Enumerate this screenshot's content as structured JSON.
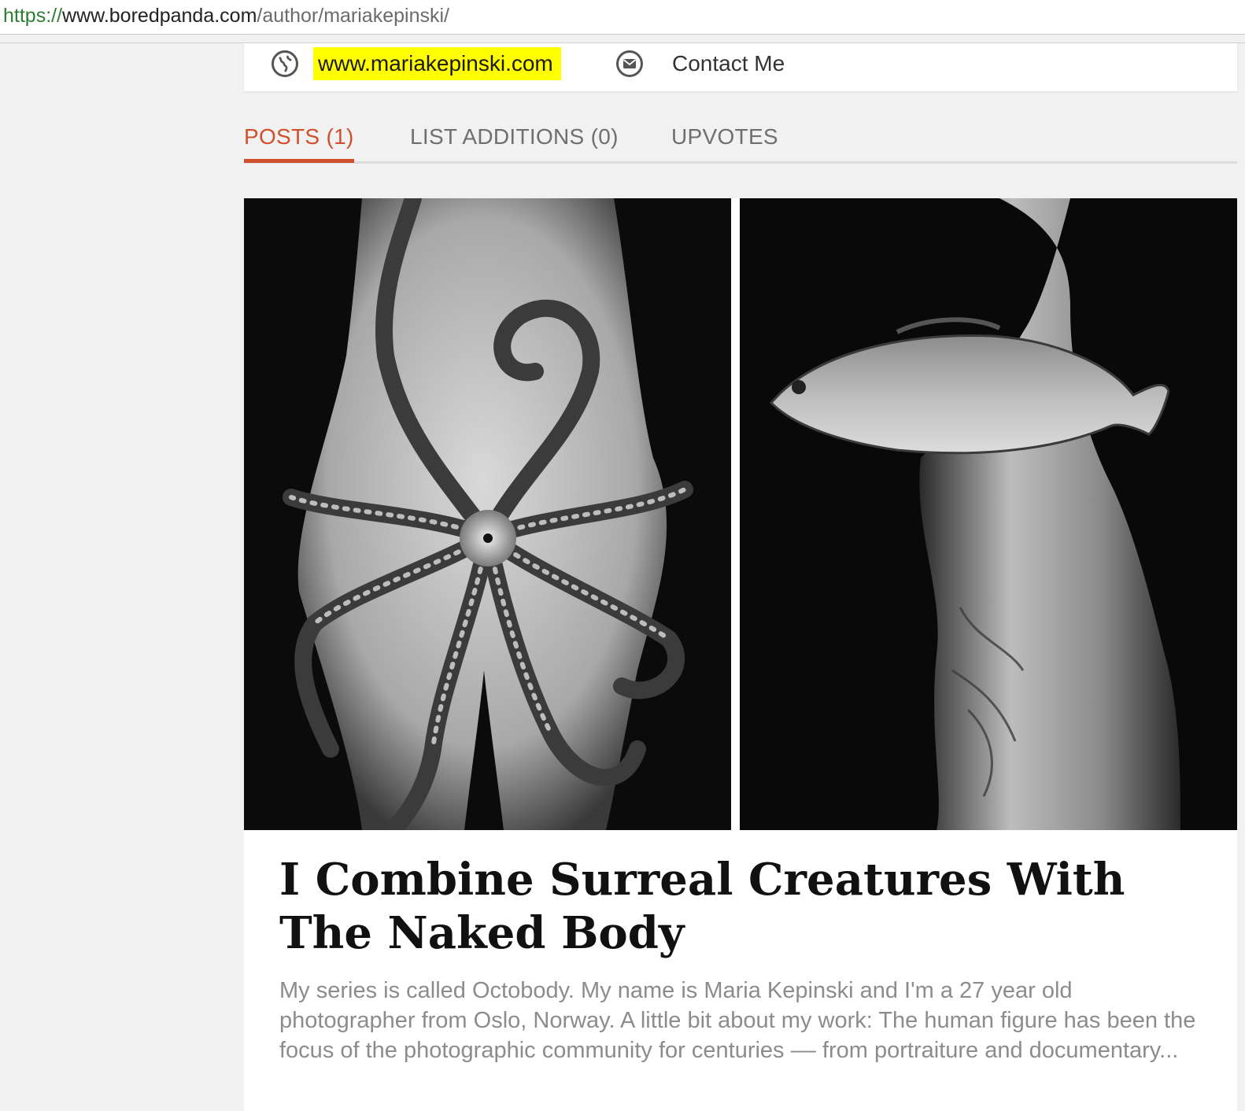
{
  "browser": {
    "url_scheme": "https://",
    "url_host": "www.boredpanda.com",
    "url_path": "/author/mariakepinski/"
  },
  "profile_links": {
    "website_label": "www.mariakepinski.com",
    "website_icon": "globe-icon",
    "contact_label": "Contact Me",
    "contact_icon": "envelope-icon",
    "highlight_color": "#ffff00"
  },
  "tabs": [
    {
      "label": "POSTS (1)",
      "active": true
    },
    {
      "label": "LIST ADDITIONS (0)",
      "active": false
    },
    {
      "label": "UPVOTES",
      "active": false
    }
  ],
  "accent_color": "#d1502c",
  "post": {
    "images": [
      {
        "subject": "octopus on body, black and white"
      },
      {
        "subject": "fish on tattooed body, black and white"
      }
    ],
    "title": "I Combine Surreal Creatures With The Naked Body",
    "excerpt": "My series is called Octobody. My name is Maria Kepinski and I'm a 27 year old photographer from Oslo, Norway. A little bit about my work: The human figure has been the focus of the photographic community for centuries –– from portraiture and documentary..."
  }
}
